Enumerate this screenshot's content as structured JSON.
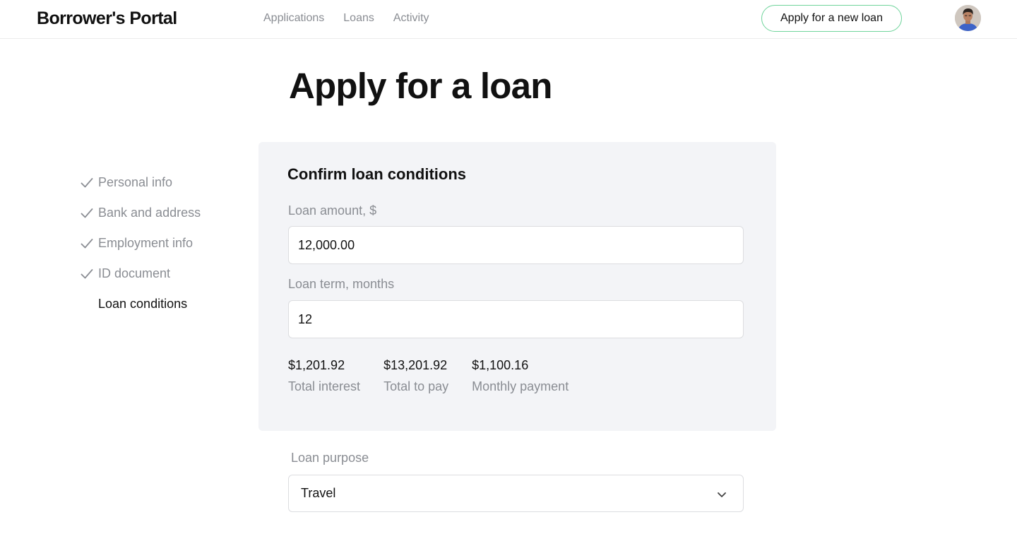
{
  "header": {
    "logo": "Borrower's Portal",
    "nav": [
      {
        "label": "Applications"
      },
      {
        "label": "Loans"
      },
      {
        "label": "Activity"
      }
    ],
    "apply_button": "Apply for a new loan",
    "accent_color": "#6fd49b"
  },
  "page_title": "Apply for a loan",
  "steps": [
    {
      "label": "Personal info",
      "done": true
    },
    {
      "label": "Bank and address",
      "done": true
    },
    {
      "label": "Employment info",
      "done": true
    },
    {
      "label": "ID document",
      "done": true
    },
    {
      "label": "Loan conditions",
      "done": false,
      "current": true
    }
  ],
  "card": {
    "title": "Confirm loan conditions",
    "amount_label": "Loan amount, $",
    "amount_value": "12,000.00",
    "term_label": "Loan term, months",
    "term_value": "12",
    "summary": [
      {
        "value": "$1,201.92",
        "caption": "Total interest"
      },
      {
        "value": "$13,201.92",
        "caption": "Total to pay"
      },
      {
        "value": "$1,100.16",
        "caption": "Monthly payment"
      }
    ]
  },
  "purpose": {
    "label": "Loan purpose",
    "selected": "Travel"
  },
  "icons": {
    "check": "check-icon",
    "chevron": "chevron-down-icon",
    "avatar": "avatar"
  }
}
